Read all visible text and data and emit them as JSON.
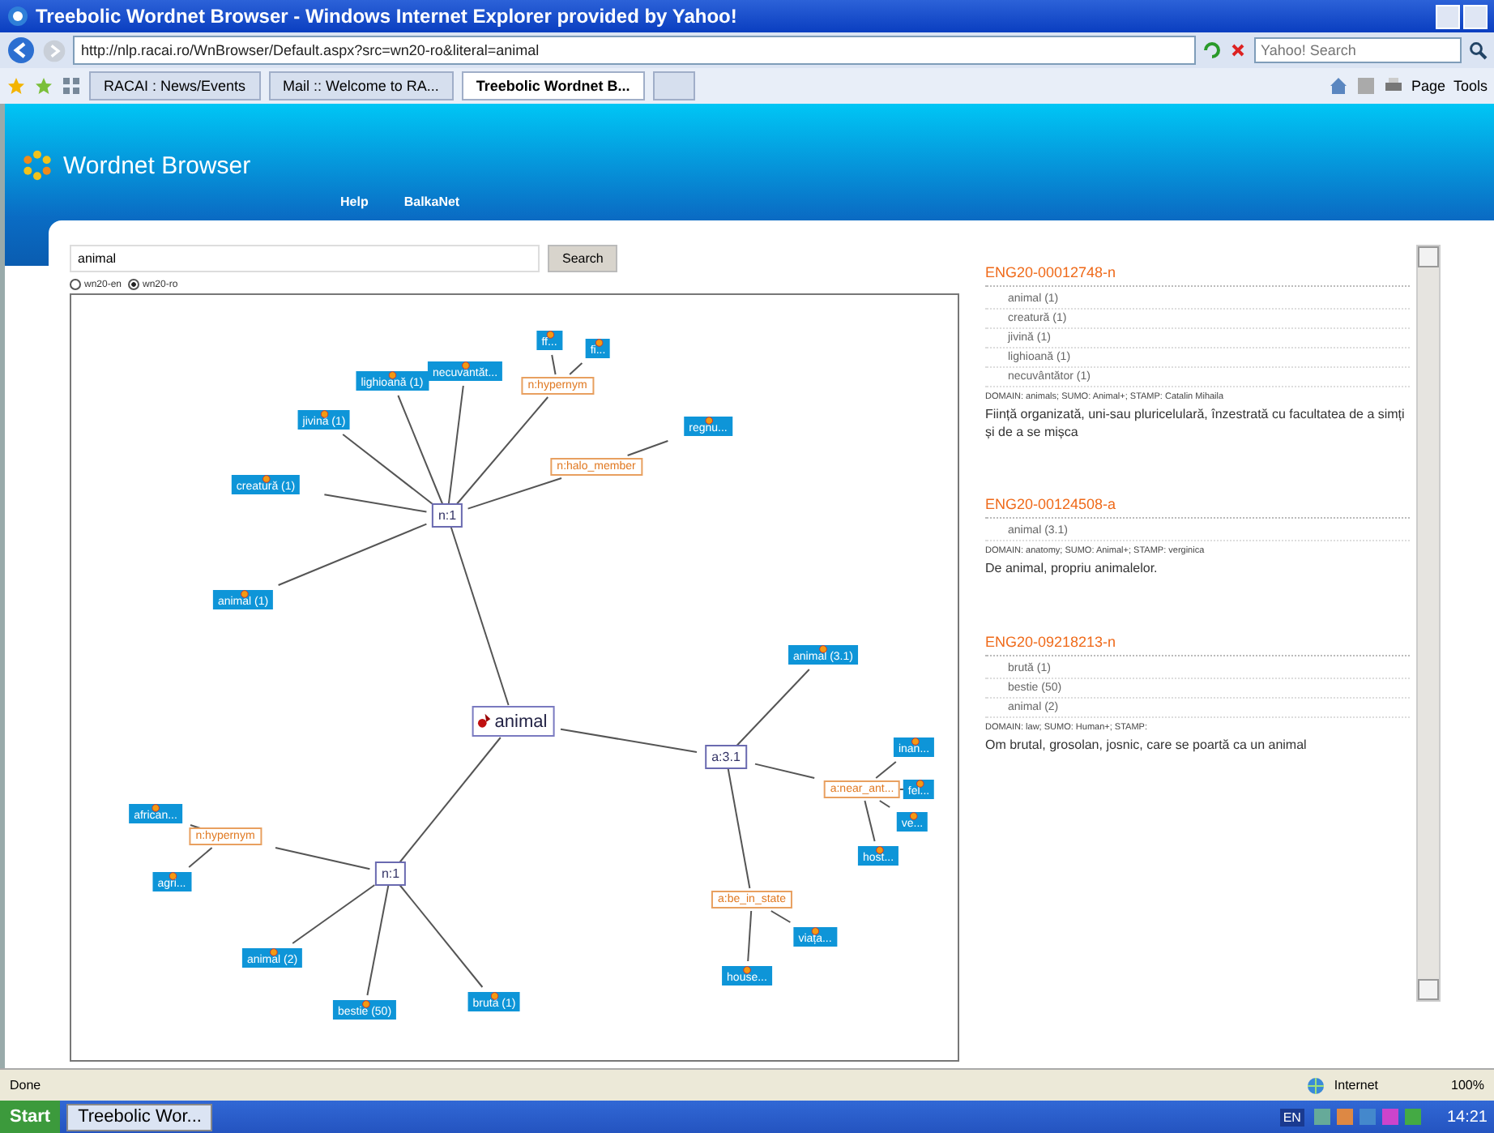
{
  "window": {
    "title": "Treebolic Wordnet Browser - Windows Internet Explorer provided by Yahoo!"
  },
  "address_bar": {
    "url": "http://nlp.racai.ro/WnBrowser/Default.aspx?src=wn20-ro&literal=animal",
    "search_placeholder": "Yahoo! Search"
  },
  "tabs": [
    {
      "label": "RACAI : News/Events",
      "selected": false
    },
    {
      "label": "Mail :: Welcome to RA...",
      "selected": false
    },
    {
      "label": "Treebolic Wordnet B...",
      "selected": true
    }
  ],
  "toolbar": {
    "page": "Page",
    "tools": "Tools"
  },
  "site": {
    "title": "Wordnet Browser",
    "nav": [
      "Help",
      "BalkaNet"
    ]
  },
  "search": {
    "value": "animal",
    "button": "Search"
  },
  "wordnets": [
    {
      "label": "wn20-en",
      "selected": false
    },
    {
      "label": "wn20-ro",
      "selected": true
    }
  ],
  "graph": {
    "kind": "root",
    "label": "animal",
    "children": [
      {
        "kind": "synset",
        "label": "n:1",
        "children": [
          {
            "kind": "word",
            "label": "creatură (1)"
          },
          {
            "kind": "word",
            "label": "jivină (1)"
          },
          {
            "kind": "word",
            "label": "lighioană (1)"
          },
          {
            "kind": "word",
            "label": "necuvântăt..."
          },
          {
            "kind": "relation",
            "label": "n:hypernym",
            "children": [
              {
                "kind": "word",
                "label": "ff..."
              },
              {
                "kind": "word",
                "label": "fi..."
              }
            ]
          },
          {
            "kind": "relation",
            "label": "n:halo_member",
            "children": [
              {
                "kind": "word",
                "label": "regnu..."
              }
            ]
          },
          {
            "kind": "word",
            "label": "animal (1)"
          }
        ]
      },
      {
        "kind": "synset",
        "label": "a:3.1",
        "children": [
          {
            "kind": "word",
            "label": "animal (3.1)"
          },
          {
            "kind": "relation",
            "label": "a:near_ant...",
            "children": [
              {
                "kind": "word",
                "label": "inan..."
              },
              {
                "kind": "word",
                "label": "fel..."
              },
              {
                "kind": "word",
                "label": "ve..."
              },
              {
                "kind": "word",
                "label": "host..."
              }
            ]
          },
          {
            "kind": "relation",
            "label": "a:be_in_state",
            "children": [
              {
                "kind": "word",
                "label": "viața..."
              },
              {
                "kind": "word",
                "label": "house..."
              }
            ]
          }
        ]
      },
      {
        "kind": "synset",
        "label": "n:1",
        "children": [
          {
            "kind": "relation",
            "label": "n:hypernym",
            "children": [
              {
                "kind": "word",
                "label": "african..."
              },
              {
                "kind": "word",
                "label": "agri..."
              }
            ]
          },
          {
            "kind": "word",
            "label": "animal (2)"
          },
          {
            "kind": "word",
            "label": "bestie (50)"
          },
          {
            "kind": "word",
            "label": "brută (1)"
          }
        ]
      }
    ]
  },
  "synsets": [
    {
      "id": "ENG20-00012748-n",
      "literals": [
        "animal (1)",
        "creatură (1)",
        "jivină (1)",
        "lighioană (1)",
        "necuvântător (1)"
      ],
      "meta": "DOMAIN: animals; SUMO: Animal+; STAMP: Catalin Mihaila",
      "definition": "Ființă organizată, uni-sau pluricelulară, înzestrată cu facultatea de a simți și de a se mișca"
    },
    {
      "id": "ENG20-00124508-a",
      "literals": [
        "animal (3.1)"
      ],
      "meta": "DOMAIN: anatomy; SUMO: Animal+; STAMP: verginica",
      "definition": "De animal, propriu animalelor."
    },
    {
      "id": "ENG20-09218213-n",
      "literals": [
        "brută (1)",
        "bestie (50)",
        "animal (2)"
      ],
      "meta": "DOMAIN: law; SUMO: Human+; STAMP:",
      "definition": "Om brutal, grosolan, josnic, care se poartă ca un animal"
    }
  ],
  "status_bar": {
    "text": "Done",
    "zone": "Internet",
    "zoom": "100%"
  },
  "taskbar": {
    "start": "Start",
    "task": "Treebolic Wor...",
    "clock": "14:21",
    "lang": "EN"
  }
}
